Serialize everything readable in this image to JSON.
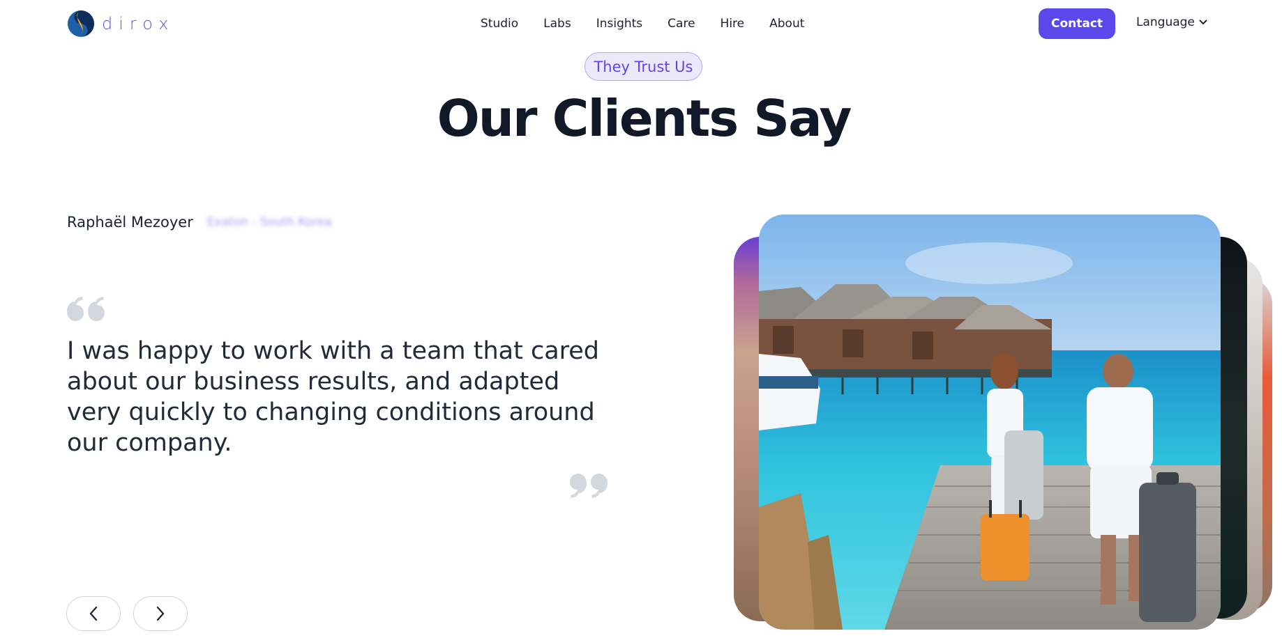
{
  "header": {
    "logo_text": "dirox",
    "nav": [
      "Studio",
      "Labs",
      "Insights",
      "Care",
      "Hire",
      "About"
    ],
    "contact_label": "Contact",
    "language_label": "Language"
  },
  "section": {
    "badge": "They Trust Us",
    "title": "Our Clients Say"
  },
  "testimonial": {
    "name": "Raphaël Mezoyer",
    "role": "Exaton - South Korea",
    "quote": "I was happy to work with a team that cared about our business results, and adapted very quickly to changing conditions around our company."
  },
  "icons": {
    "logo": "dirox-logo-icon",
    "language": "chevron-down-icon",
    "prev": "chevron-left-icon",
    "next": "chevron-right-icon",
    "quote_open": "quote-open-icon",
    "quote_close": "quote-close-icon"
  },
  "colors": {
    "accent": "#5b48ea",
    "badge_bg": "#ece9fd",
    "title": "#111827",
    "quote_mark": "#d3d7de"
  }
}
